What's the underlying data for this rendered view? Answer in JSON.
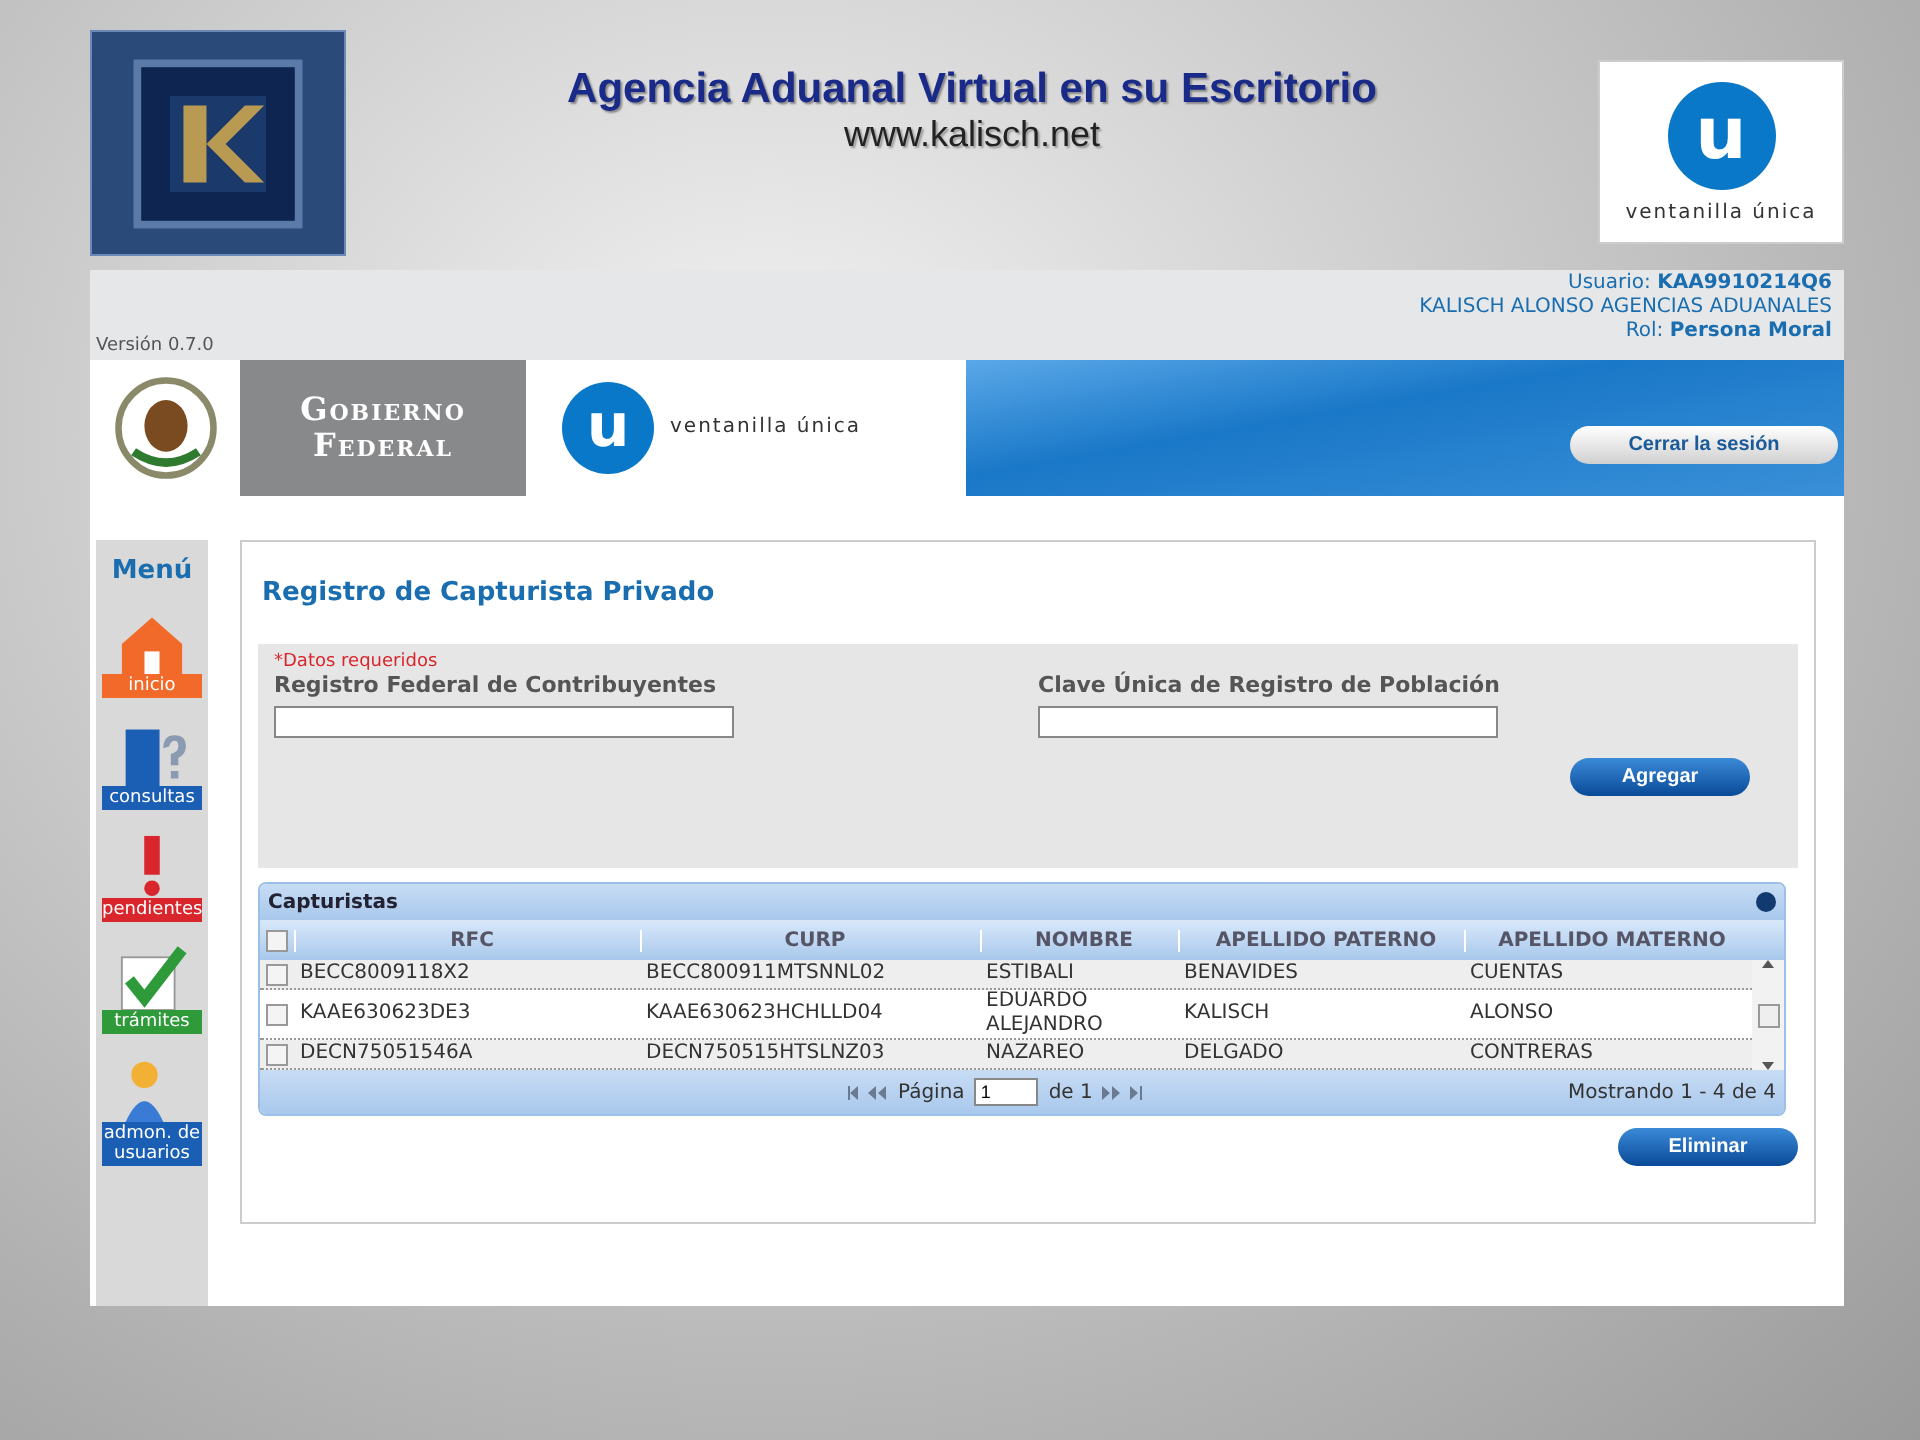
{
  "slide": {
    "title": "Agencia Aduanal Virtual en su Escritorio",
    "url": "www.kalisch.net",
    "partner_logo_letter": "u",
    "partner_logo_text": "ventanilla única"
  },
  "user_bar": {
    "user_label": "Usuario:",
    "user_id": "KAA9910214Q6",
    "company": "KALISCH ALONSO AGENCIAS ADUANALES",
    "role_label": "Rol:",
    "role": "Persona Moral",
    "version": "Versión 0.7.0"
  },
  "banner": {
    "gov_line1": "Gobierno",
    "gov_line2": "Federal",
    "logo_letter": "u",
    "logo_text": "ventanilla única",
    "logout": "Cerrar la sesión"
  },
  "sidebar": {
    "title": "Menú",
    "items": [
      {
        "label": "inicio",
        "color": "#f26a2a"
      },
      {
        "label": "consultas",
        "color": "#1a5fb4"
      },
      {
        "label": "pendientes",
        "color": "#d8262c"
      },
      {
        "label": "trámites",
        "color": "#2e9a3a"
      },
      {
        "label": "admon. de usuarios",
        "color": "#1a5fb4"
      }
    ]
  },
  "form": {
    "title": "Registro de Capturista Privado",
    "required_note": "*Datos requeridos",
    "fields": [
      {
        "label": "Registro Federal de Contribuyentes"
      },
      {
        "label": "Clave Única de Registro de Población"
      }
    ],
    "add_button": "Agregar"
  },
  "table": {
    "title": "Capturistas",
    "header_checked": false,
    "columns": [
      "RFC",
      "CURP",
      "NOMBRE",
      "APELLIDO PATERNO",
      "APELLIDO MATERNO"
    ],
    "rows": [
      {
        "checked": false,
        "cells": [
          "BECC8009118X2",
          "BECC800911MTSNNL02",
          "ESTIBALI",
          "BENAVIDES",
          "CUENTAS"
        ]
      },
      {
        "checked": false,
        "cells": [
          "KAAE630623DE3",
          "KAAE630623HCHLLD04",
          "EDUARDO ALEJANDRO",
          "KALISCH",
          "ALONSO"
        ]
      },
      {
        "checked": false,
        "cells": [
          "DECN75051546A",
          "DECN750515HTSLNZ03",
          "NAZAREO",
          "DELGADO",
          "CONTRERAS"
        ]
      }
    ],
    "pager": {
      "page_label": "Página",
      "page": "1",
      "of": "de 1",
      "summary": "Mostrando 1 - 4 de 4"
    },
    "delete_button": "Eliminar"
  }
}
